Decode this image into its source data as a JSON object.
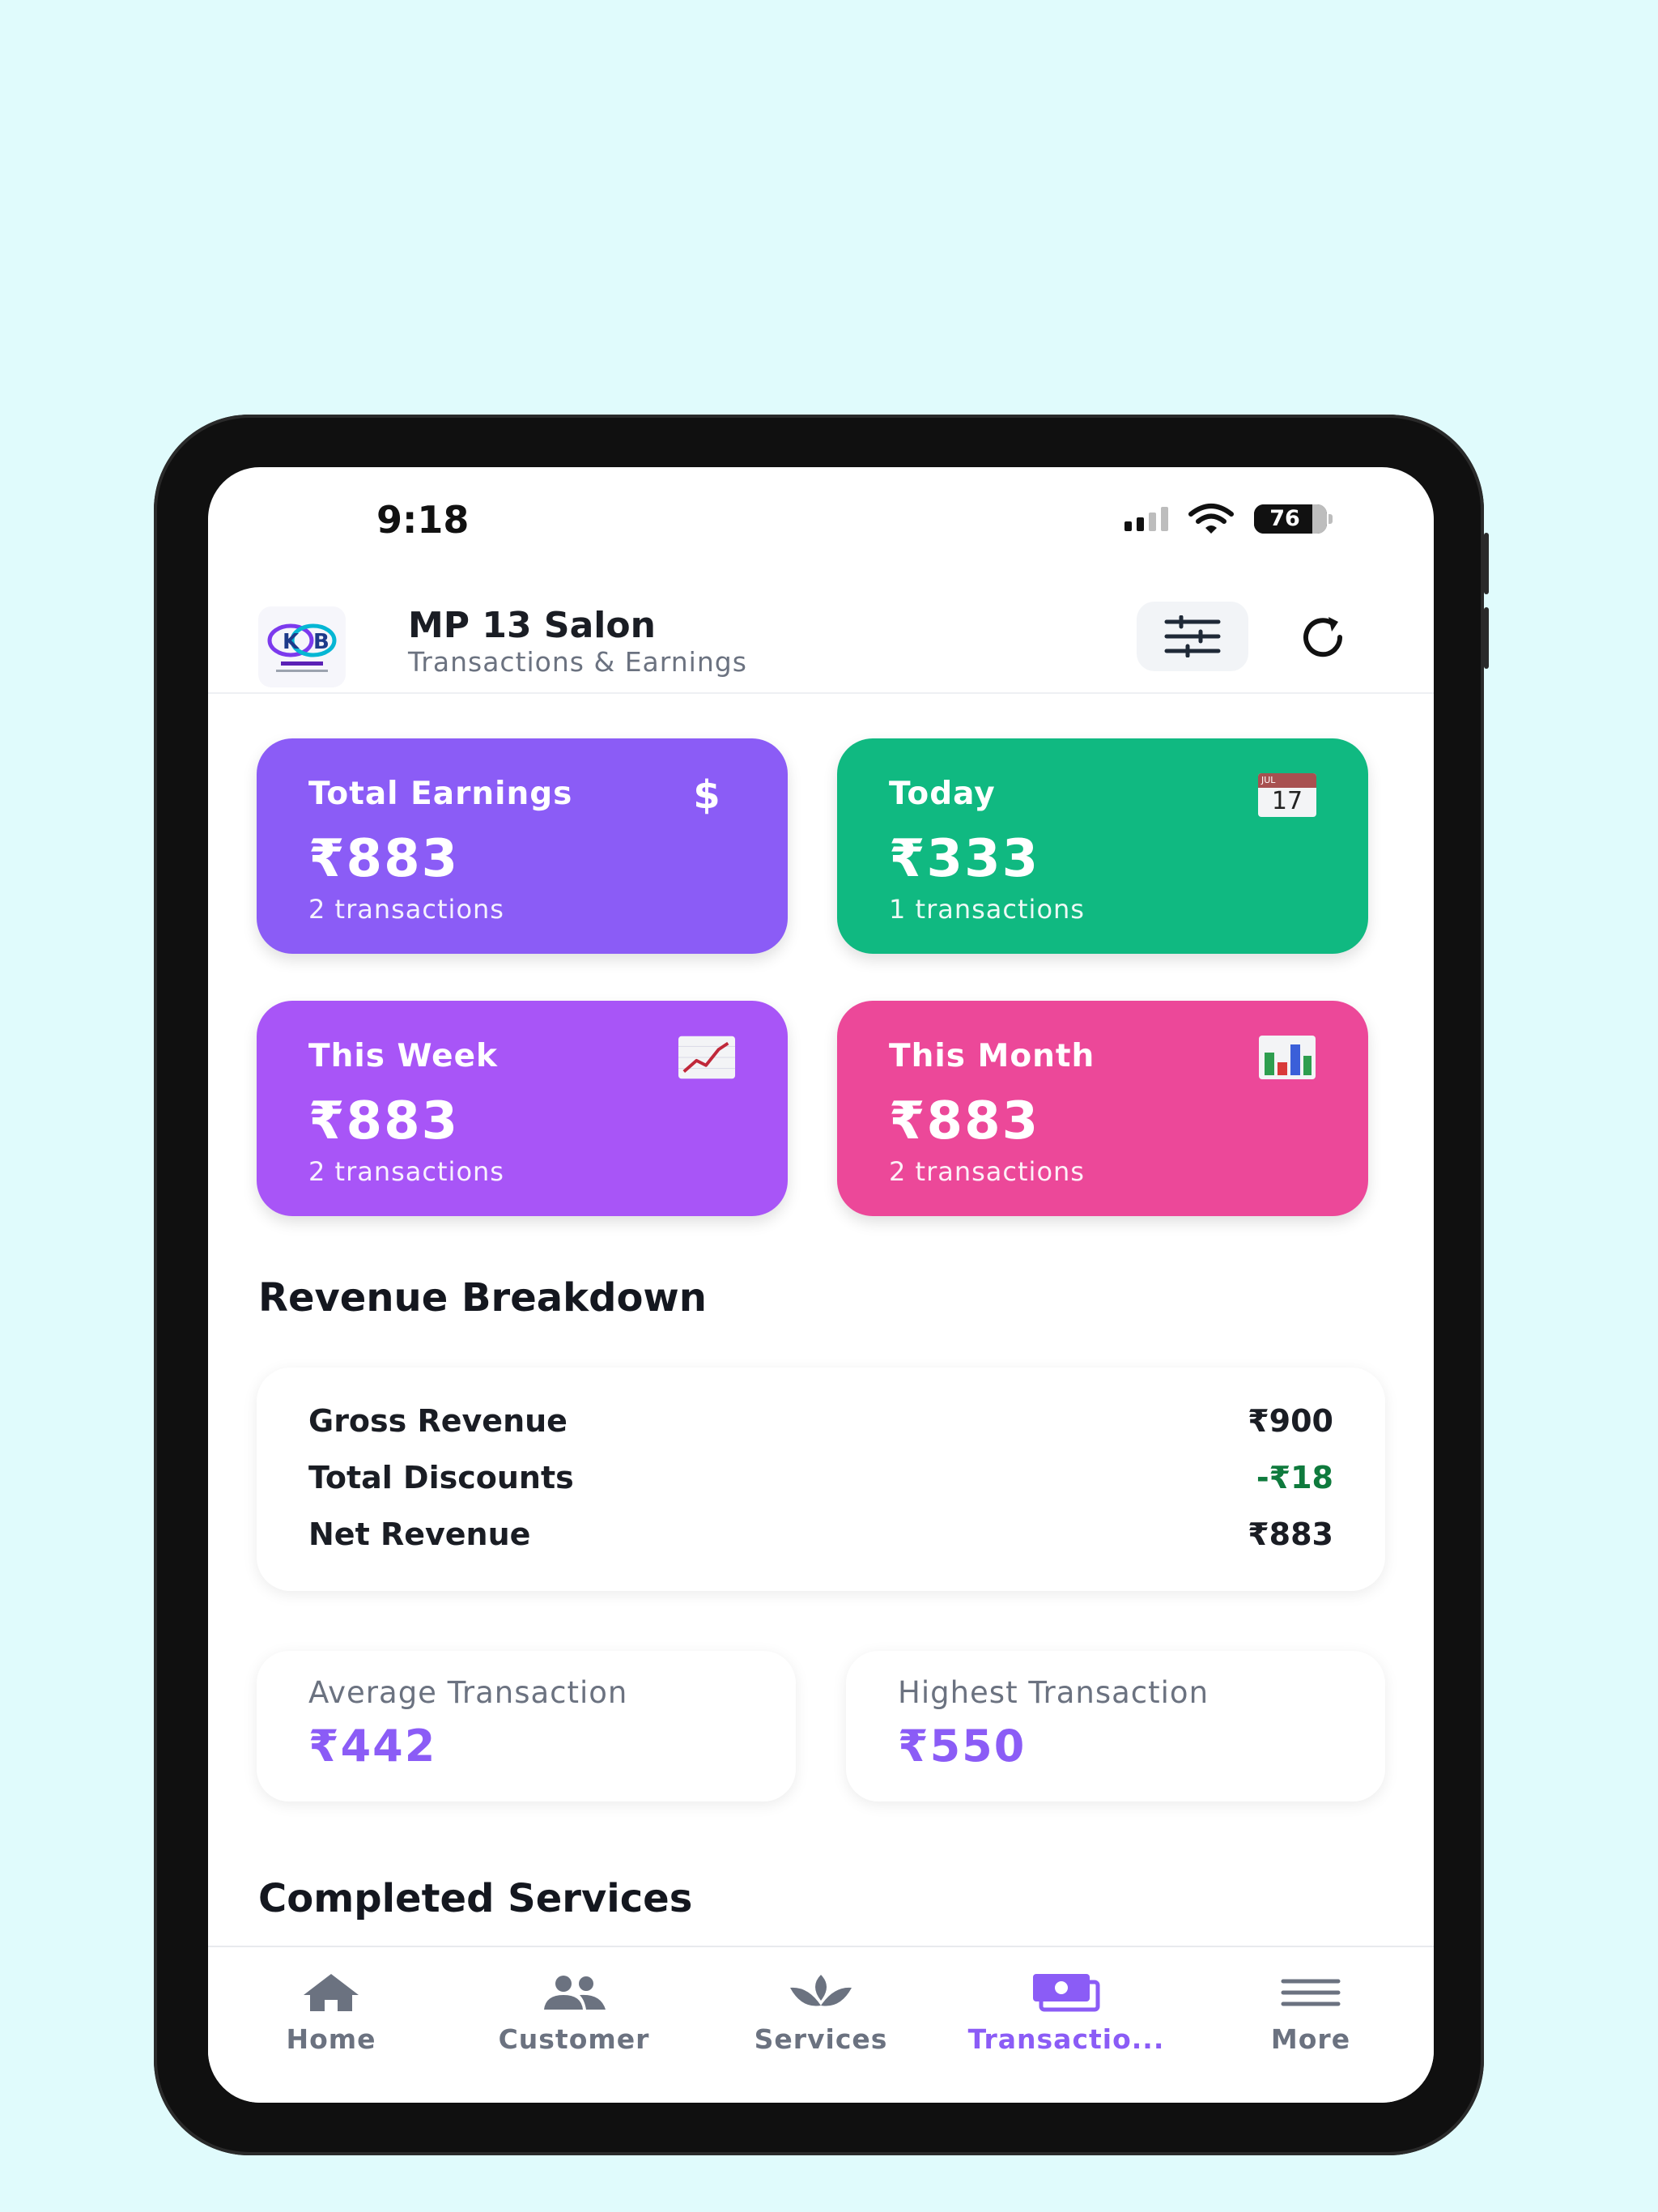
{
  "status_bar": {
    "time": "9:18",
    "battery": "76"
  },
  "header": {
    "title": "MP 13 Salon",
    "subtitle": "Transactions & Earnings"
  },
  "cards": [
    {
      "label": "Total Earnings",
      "amount": "₹883",
      "sub": "2 transactions",
      "color": "#8b5cf6",
      "icon": "dollar-icon",
      "icon_glyph": "$"
    },
    {
      "label": "Today",
      "amount": "₹333",
      "sub": "1 transactions",
      "color": "#10b981",
      "icon": "calendar-icon",
      "icon_month": "JUL",
      "icon_day": "17"
    },
    {
      "label": "This Week",
      "amount": "₹883",
      "sub": "2 transactions",
      "color": "#a855f7",
      "icon": "trend-chart-icon"
    },
    {
      "label": "This Month",
      "amount": "₹883",
      "sub": "2 transactions",
      "color": "#ec4899",
      "icon": "bar-chart-icon"
    }
  ],
  "revenue": {
    "title": "Revenue Breakdown",
    "rows": [
      {
        "label": "Gross Revenue",
        "value": "₹900"
      },
      {
        "label": "Total Discounts",
        "value": "-₹18"
      },
      {
        "label": "Net Revenue",
        "value": "₹883"
      }
    ]
  },
  "stats": [
    {
      "label": "Average Transaction",
      "value": "₹442"
    },
    {
      "label": "Highest Transaction",
      "value": "₹550"
    }
  ],
  "completed_title": "Completed Services",
  "tabs": [
    {
      "label": "Home",
      "icon": "home-icon",
      "active": false
    },
    {
      "label": "Customer",
      "icon": "users-icon",
      "active": false
    },
    {
      "label": "Services",
      "icon": "lotus-icon",
      "active": false
    },
    {
      "label": "Transactio...",
      "icon": "cash-icon",
      "active": true
    },
    {
      "label": "More",
      "icon": "menu-icon",
      "active": false
    }
  ],
  "colors": {
    "accent": "#8b5cf6",
    "discount_green": "#0f7a3d",
    "background": "#e0fbfc"
  }
}
